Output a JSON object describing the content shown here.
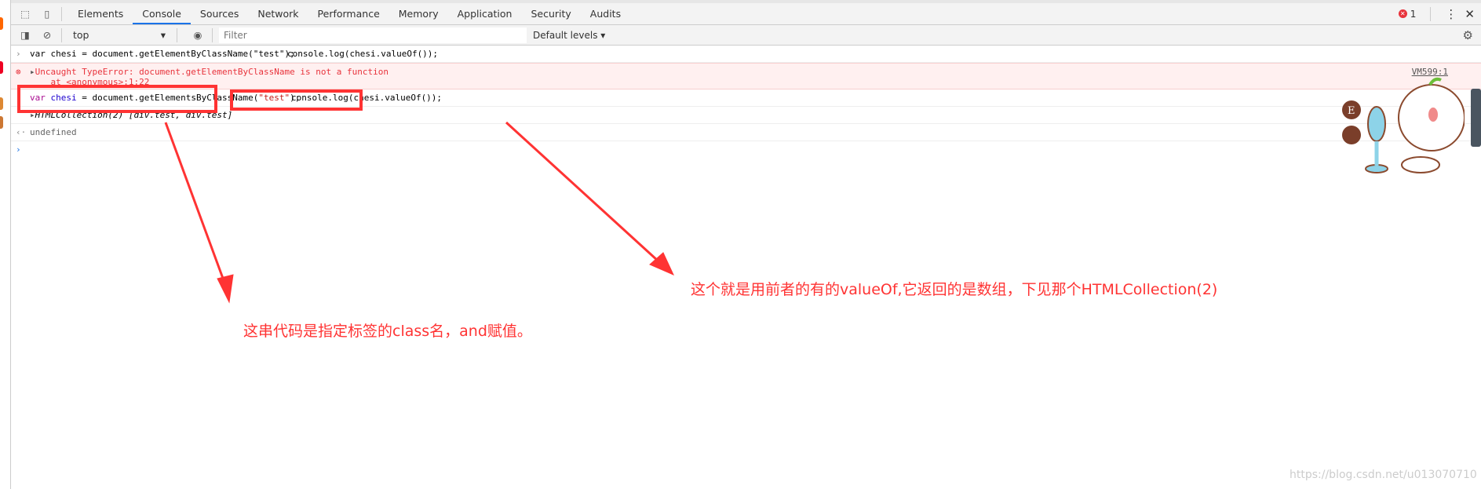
{
  "tabs": [
    "Elements",
    "Console",
    "Sources",
    "Network",
    "Performance",
    "Memory",
    "Application",
    "Security",
    "Audits"
  ],
  "active_tab": "Console",
  "error_count": "1",
  "toolbar": {
    "context": "top",
    "filter_placeholder": "Filter",
    "levels": "Default levels ▾"
  },
  "console": {
    "line1_a": "var chesi = document.getElementByClassName(\"test\");",
    "line1_b": "console.log(chesi.valueOf());",
    "error_msg": "Uncaught TypeError: document.getElementByClassName is not a function",
    "error_at": "    at <anonymous>:1:22",
    "error_src": "VM599:1",
    "line3_kw": "var",
    "line3_var": " chesi",
    "line3_mid": " = document.getElementsByClassName(",
    "line3_str": "\"test\"",
    "line3_end": ");",
    "line3_b": "console.log(chesi.valueOf());",
    "result": "HTMLCollection(2) [div.test, div.test]",
    "undefined": "undefined"
  },
  "annotations": {
    "right": "这个就是用前者的有的valueOf,它返回的是数组，下见那个HTMLCollection(2)",
    "left": "这串代码是指定标签的class名，and赋值。"
  },
  "watermark": "https://blog.csdn.net/u013070710",
  "colors": {
    "accent": "#1a73e8",
    "annotation": "#ff3333",
    "error": "#e8333c"
  }
}
